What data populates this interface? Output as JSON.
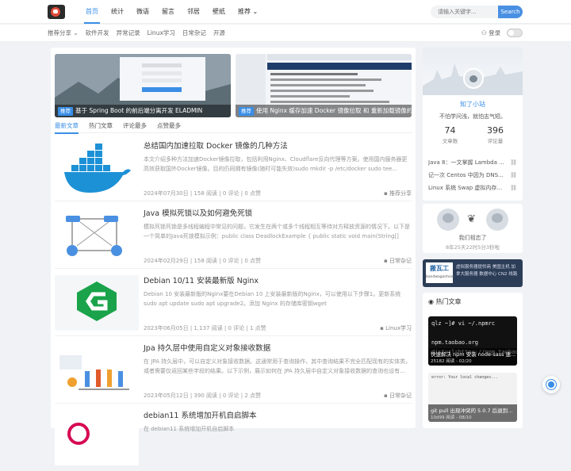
{
  "header": {
    "nav": [
      "首页",
      "统计",
      "微语",
      "留言",
      "邻居",
      "壁纸",
      "推荐"
    ],
    "search_placeholder": "请输入关键字...",
    "search_button": "Search"
  },
  "subnav": {
    "items": [
      "推荐分享",
      "软件开发",
      "异常记录",
      "Linux学习",
      "日常杂记",
      "开源"
    ],
    "login": "登录"
  },
  "banners": [
    {
      "tag": "推荐",
      "title": "基于 Spring Boot 的前后端分离开发 ELADMIN"
    },
    {
      "tag": "推荐",
      "title": "使用 Nginx 缓存加速 Docker 镜像拉取 和 重新加载镜像的问题"
    }
  ],
  "tabs": [
    "最新文章",
    "热门文章",
    "评论最多",
    "点赞最多"
  ],
  "articles": [
    {
      "title": "总结国内加速拉取 Docker 镜像的几种方法",
      "desc": "本文介绍多种方法加速Docker镜像拉取，包括利用Nginx、Cloudflare反向代理等方案。使用国内服务器更高效获取国外Docker镜像。目的仍同拥有镜像(随时可能失效)sudo mkdir -p /etc/docker sudo tee...",
      "meta": "2024年07月30日 | 158 阅读 | 0 评论 | 0 点赞",
      "cat": "推荐分享"
    },
    {
      "title": "Java 模拟死锁以及如何避免死锁",
      "desc": "模拟死锁死锁是多线程编程中常见的问题，它发生在两个或多个线程相互等待对方释放资源的情况下。以下是一个简单的Java死锁模拟示例：public class DeadlockExample { public static void main(String[] args) { // 创建...",
      "meta": "2024年02月29日 | 158 阅读 | 0 评论 | 0 点赞",
      "cat": "日常杂记"
    },
    {
      "title": "Debian 10/11 安装最新版 Nginx",
      "desc": "Debian 10 安装最新版的Nginx要在Debian 10 上安装最新版的Nginx，可以使用以下步骤1。更新系统sudo apt update sudo apt upgrade2。添加 Nginx 的存储库密钥wget http://nginx.org/keys/nginx_signing.key sudo ap...",
      "meta": "2023年06月05日 | 1,137 阅读 | 0 评论 | 1 点赞",
      "cat": "Linux学习"
    },
    {
      "title": "Jpa 持久层中使用自定义对象接收数据",
      "desc": "在 JPA 持久层中，可以自定义对象接收数据。这通常用于查询操作，其中查询结果不完全匹配现有的实体类，或者需要仅返回某些字段的结果。以下示例，展示如何在 JPA 持久层中自定义对象接收数据的查询也设有...",
      "meta": "2023年05月12日 | 390 阅读 | 0 评论 | 2 点赞",
      "cat": "日常杂记"
    },
    {
      "title": "debian11 系统增加开机自启脚本",
      "desc": "在 debian11 系统增加开机自启脚本",
      "meta": "",
      "cat": ""
    }
  ],
  "profile": {
    "name": "知了小站",
    "motto": "不怕学问浅，就怕志气短。",
    "articles_count": "74",
    "articles_label": "文章数",
    "comments_count": "396",
    "comments_label": "评论量"
  },
  "links": [
    "Java 8：一文掌握 Lambda ...",
    "记一次 Centos 中因为 DNS...",
    "Linux 系统 Swap 虚拟内存..."
  ],
  "recent": {
    "text": "我们相恋了",
    "sub": "8年25天22时5分3秒啦"
  },
  "ad": {
    "logo": "搬瓦工",
    "logo_sub": "bandwagonhost",
    "text": "虚拟服务器提供商 美国主机 加拿大服务器 数据中心 CN2 线路"
  },
  "hot": {
    "title": "热门文章",
    "items": [
      {
        "code": "qlz ~]# vi ~/.npmrc\n\nnpm.taobao.org\ndisturl=https://npm.taobao.org/mirrors",
        "title": "快速解决 npm 安装 node-sass 速...",
        "sub": "25182 阅读 - 02/20"
      },
      {
        "code": "error: Your local changes...",
        "title": "git pull 出现冲突的 5.0.7 后退到...",
        "sub": "10d99 阅读 - 08/10"
      }
    ]
  },
  "colors": {
    "accent": "#3a8ee6"
  }
}
